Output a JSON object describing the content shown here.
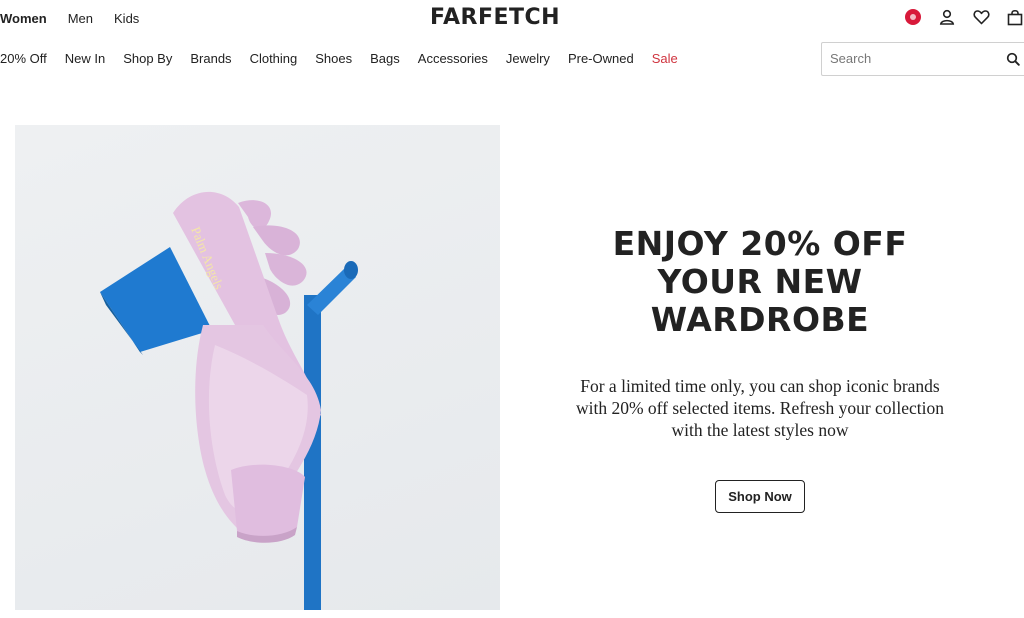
{
  "header": {
    "gender_tabs": [
      {
        "label": "Women",
        "active": true
      },
      {
        "label": "Men",
        "active": false
      },
      {
        "label": "Kids",
        "active": false
      }
    ],
    "logo": "FARFETCH",
    "icons": [
      "region-flag-icon",
      "account-icon",
      "wishlist-heart-icon",
      "shopping-bag-icon"
    ]
  },
  "nav": {
    "items": [
      "20% Off",
      "New In",
      "Shop By",
      "Brands",
      "Clothing",
      "Shoes",
      "Bags",
      "Accessories",
      "Jewelry",
      "Pre-Owned",
      "Sale"
    ],
    "sale_color": "#d0343f"
  },
  "search": {
    "placeholder": "Search",
    "value": ""
  },
  "hero": {
    "headline_lines": [
      "ENJOY 20% OFF",
      "YOUR NEW",
      "WARDROBE"
    ],
    "subcopy": "For a limited time only, you can shop iconic brands with 20% off selected items. Refresh your collection with the latest styles now",
    "cta_label": "Shop Now",
    "image": {
      "description_icon": "pink-sandal-on-blue-stand-image",
      "shoe_color": "#e2bfe0",
      "stand_color": "#1f78c8",
      "shoe_text": "Palm Angels"
    }
  }
}
